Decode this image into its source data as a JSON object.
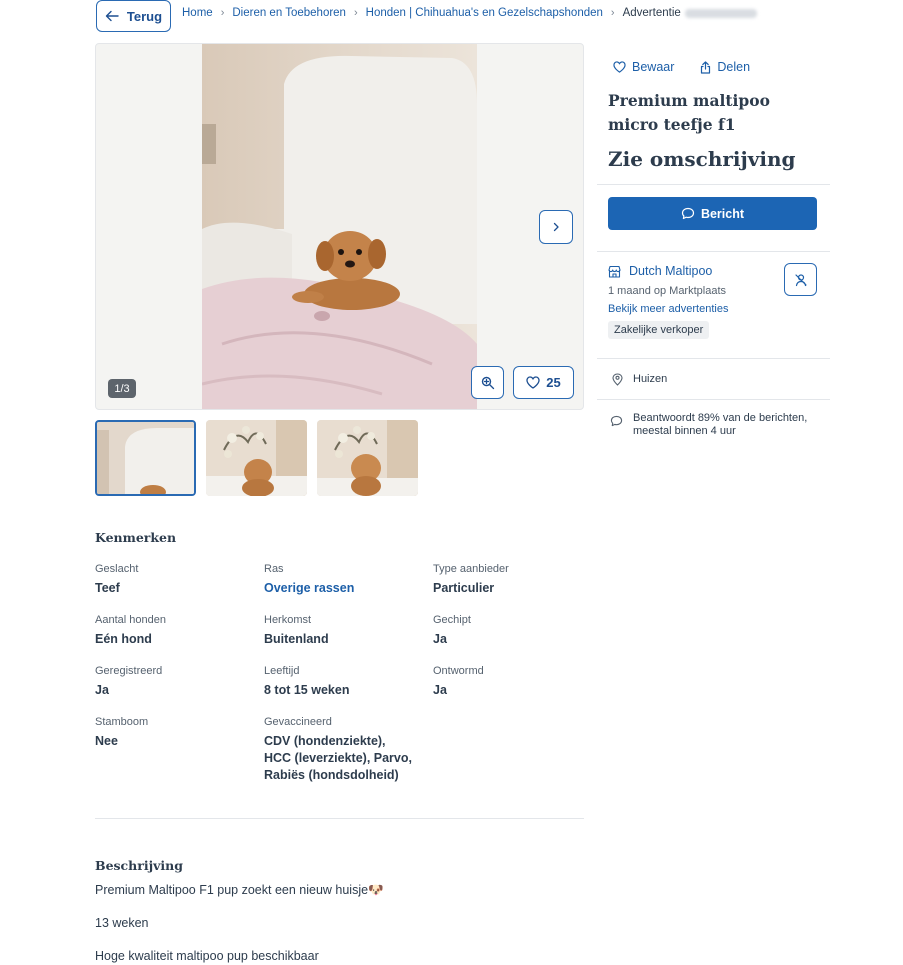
{
  "topbar": {
    "back_label": "Terug",
    "breadcrumbs": [
      "Home",
      "Dieren en Toebehoren",
      "Honden | Chihuahua's en Gezelschapshonden",
      "Advertentie"
    ]
  },
  "gallery": {
    "counter": "1/3",
    "favorites_count": "25"
  },
  "sidebar": {
    "save_label": "Bewaar",
    "share_label": "Delen",
    "title": "Premium maltipoo micro teefje f1",
    "price": "Zie omschrijving",
    "message_label": "Bericht",
    "seller": {
      "name": "Dutch Maltipoo",
      "since": "1 maand op Marktplaats",
      "more_link": "Bekijk meer advertenties",
      "badge": "Zakelijke verkoper"
    },
    "location": "Huizen",
    "response": "Beantwoordt 89% van de berichten, meestal binnen 4 uur"
  },
  "characteristics": {
    "title": "Kenmerken",
    "items": [
      {
        "label": "Geslacht",
        "value": "Teef"
      },
      {
        "label": "Ras",
        "value": "Overige rassen"
      },
      {
        "label": "Type aanbieder",
        "value": "Particulier"
      },
      {
        "label": "Aantal honden",
        "value": "Eén hond"
      },
      {
        "label": "Herkomst",
        "value": "Buitenland"
      },
      {
        "label": "Gechipt",
        "value": "Ja"
      },
      {
        "label": "Geregistreerd",
        "value": "Ja"
      },
      {
        "label": "Leeftijd",
        "value": "8 tot 15 weken"
      },
      {
        "label": "Ontwormd",
        "value": "Ja"
      },
      {
        "label": "Stamboom",
        "value": "Nee"
      },
      {
        "label": "Gevaccineerd",
        "value": "CDV (hondenziekte), HCC (leverziekte), Parvo, Rabiës (hondsdolheid)"
      }
    ]
  },
  "description": {
    "title": "Beschrijving",
    "line1": "Premium Maltipoo F1 pup zoekt een nieuw huisje🐶",
    "line2": "13 weken",
    "line3": "Hoge kwaliteit maltipoo pup beschikbaar"
  },
  "colors": {
    "primary": "#1c65b4",
    "link": "#1d5fa8",
    "text": "#2d3c4d"
  }
}
